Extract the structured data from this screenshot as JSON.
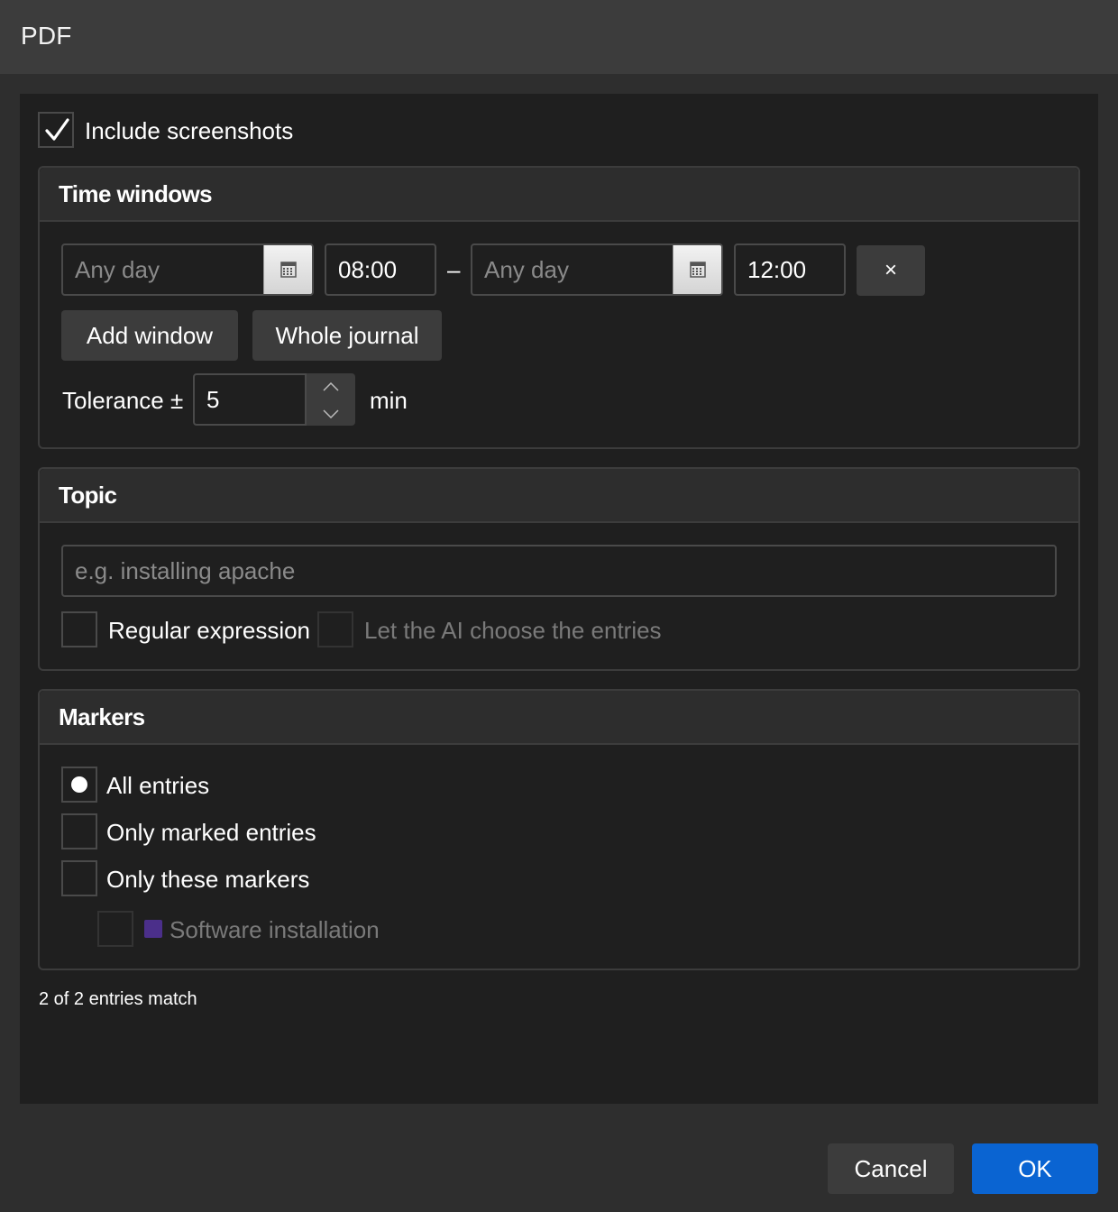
{
  "window": {
    "title": "PDF"
  },
  "include_screenshots": {
    "label": "Include screenshots",
    "checked": true
  },
  "time_windows": {
    "heading": "Time windows",
    "from_date_placeholder": "Any day",
    "from_time": "08:00",
    "separator": "–",
    "to_date_placeholder": "Any day",
    "to_time": "12:00",
    "remove_label": "×",
    "add_window_label": "Add window",
    "whole_journal_label": "Whole journal",
    "tolerance_label": "Tolerance ±",
    "tolerance_value": "5",
    "tolerance_unit": "min"
  },
  "topic": {
    "heading": "Topic",
    "placeholder": "e.g. installing apache",
    "regex_label": "Regular expression",
    "ai_label": "Let the AI choose the entries"
  },
  "markers": {
    "heading": "Markers",
    "options": [
      {
        "label": "All entries",
        "selected": true
      },
      {
        "label": "Only marked entries",
        "selected": false
      },
      {
        "label": "Only these markers",
        "selected": false
      }
    ],
    "items": [
      {
        "label": "Software installation",
        "color": "#4b2f8a"
      }
    ]
  },
  "status": "2 of 2 entries match",
  "footer": {
    "cancel_label": "Cancel",
    "ok_label": "OK",
    "ok_color": "#0a64d2"
  }
}
